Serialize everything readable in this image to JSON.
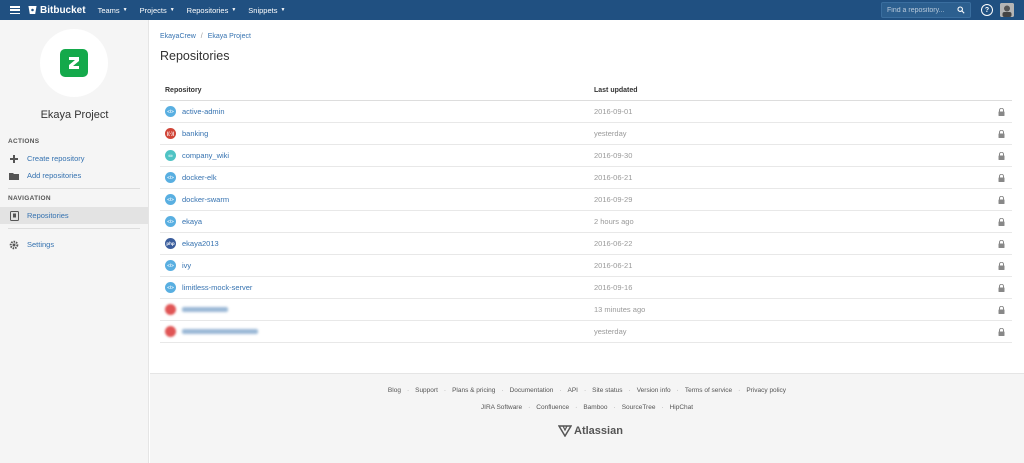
{
  "topbar": {
    "brand": "Bitbucket",
    "nav": [
      {
        "label": "Teams"
      },
      {
        "label": "Projects"
      },
      {
        "label": "Repositories"
      },
      {
        "label": "Snippets"
      }
    ],
    "search_placeholder": "Find a repository...",
    "help": "?"
  },
  "sidebar": {
    "project_name": "Ekaya Project",
    "actions_title": "ACTIONS",
    "create_repository": "Create repository",
    "add_repositories": "Add repositories",
    "navigation_title": "NAVIGATION",
    "repositories": "Repositories",
    "settings": "Settings"
  },
  "main": {
    "breadcrumb": {
      "team": "EkayaCrew",
      "separator": "/",
      "project": "Ekaya Project"
    },
    "title": "Repositories",
    "columns": {
      "repository": "Repository",
      "last_updated": "Last updated"
    },
    "rows": [
      {
        "name": "active-admin",
        "updated": "2016-09-01",
        "icon": "code-icon",
        "color": "#59afe1"
      },
      {
        "name": "banking",
        "updated": "yesterday",
        "icon": "wifi-icon",
        "color": "#d04437"
      },
      {
        "name": "company_wiki",
        "updated": "2016-09-30",
        "icon": "wiki-icon",
        "color": "#4fc3c4"
      },
      {
        "name": "docker-elk",
        "updated": "2016-06-21",
        "icon": "code-icon",
        "color": "#59afe1"
      },
      {
        "name": "docker-swarm",
        "updated": "2016-09-29",
        "icon": "code-icon",
        "color": "#59afe1"
      },
      {
        "name": "ekaya",
        "updated": "2 hours ago",
        "icon": "code-icon",
        "color": "#59afe1"
      },
      {
        "name": "ekaya2013",
        "updated": "2016-06-22",
        "icon": "php-icon",
        "color": "#3a5d9c"
      },
      {
        "name": "ivy",
        "updated": "2016-06-21",
        "icon": "code-icon",
        "color": "#59afe1"
      },
      {
        "name": "limitless-mock-server",
        "updated": "2016-09-16",
        "icon": "code-icon",
        "color": "#59afe1"
      },
      {
        "name": "",
        "updated": "13 minutes ago",
        "icon": "blurred-icon",
        "color": "#e05555"
      },
      {
        "name": "",
        "updated": "yesterday",
        "icon": "blurred-icon",
        "color": "#e05555"
      }
    ]
  },
  "footer": {
    "row1": [
      "Blog",
      "Support",
      "Plans & pricing",
      "Documentation",
      "API",
      "Site status",
      "Version info",
      "Terms of service",
      "Privacy policy"
    ],
    "row2": [
      "JIRA Software",
      "Confluence",
      "Bamboo",
      "SourceTree",
      "HipChat"
    ],
    "brand": "Atlassian"
  },
  "colors": {
    "topbar": "#205081",
    "link": "#3572b0",
    "project_logo": "#14a94b"
  }
}
